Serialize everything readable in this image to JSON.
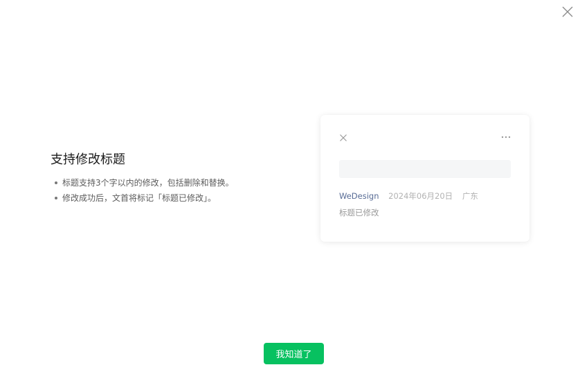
{
  "dialog": {
    "close_icon": "close-icon"
  },
  "feature": {
    "title": "支持修改标题",
    "items": [
      "标题支持3个字以内的修改，包括删除和替换。",
      "修改成功后，文首将标记「标题已修改」。"
    ]
  },
  "preview_card": {
    "close_icon": "close-icon",
    "more_icon": "more-icon",
    "author": "WeDesign",
    "date": "2024年06月20日",
    "location": "广东",
    "edited_label": "标题已修改"
  },
  "actions": {
    "confirm_label": "我知道了"
  },
  "colors": {
    "primary": "#07c160",
    "link": "#576b95",
    "placeholder_bg": "#f5f6f7",
    "muted_text": "#b2b2b2"
  }
}
